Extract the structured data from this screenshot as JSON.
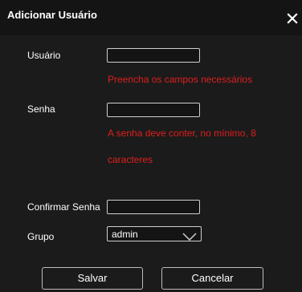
{
  "dialog": {
    "title": "Adicionar Usuário",
    "close_icon": "close-icon"
  },
  "form": {
    "username": {
      "label": "Usuário",
      "value": "",
      "error": "Preencha os campos necessários"
    },
    "password": {
      "label": "Senha",
      "value": "",
      "error_line1": "A senha deve conter, no mínimo, 8",
      "error_line2": "caracteres"
    },
    "confirm_password": {
      "label": "Confirmar Senha",
      "value": ""
    },
    "group": {
      "label": "Grupo",
      "selected": "admin",
      "chevron_icon": "chevron-down-icon"
    }
  },
  "buttons": {
    "save": "Salvar",
    "cancel": "Cancelar"
  },
  "colors": {
    "background": "#1b1b1b",
    "titlebar": "#141414",
    "error": "#e01e1e",
    "border": "#cfcfcf",
    "text": "#ffffff"
  }
}
